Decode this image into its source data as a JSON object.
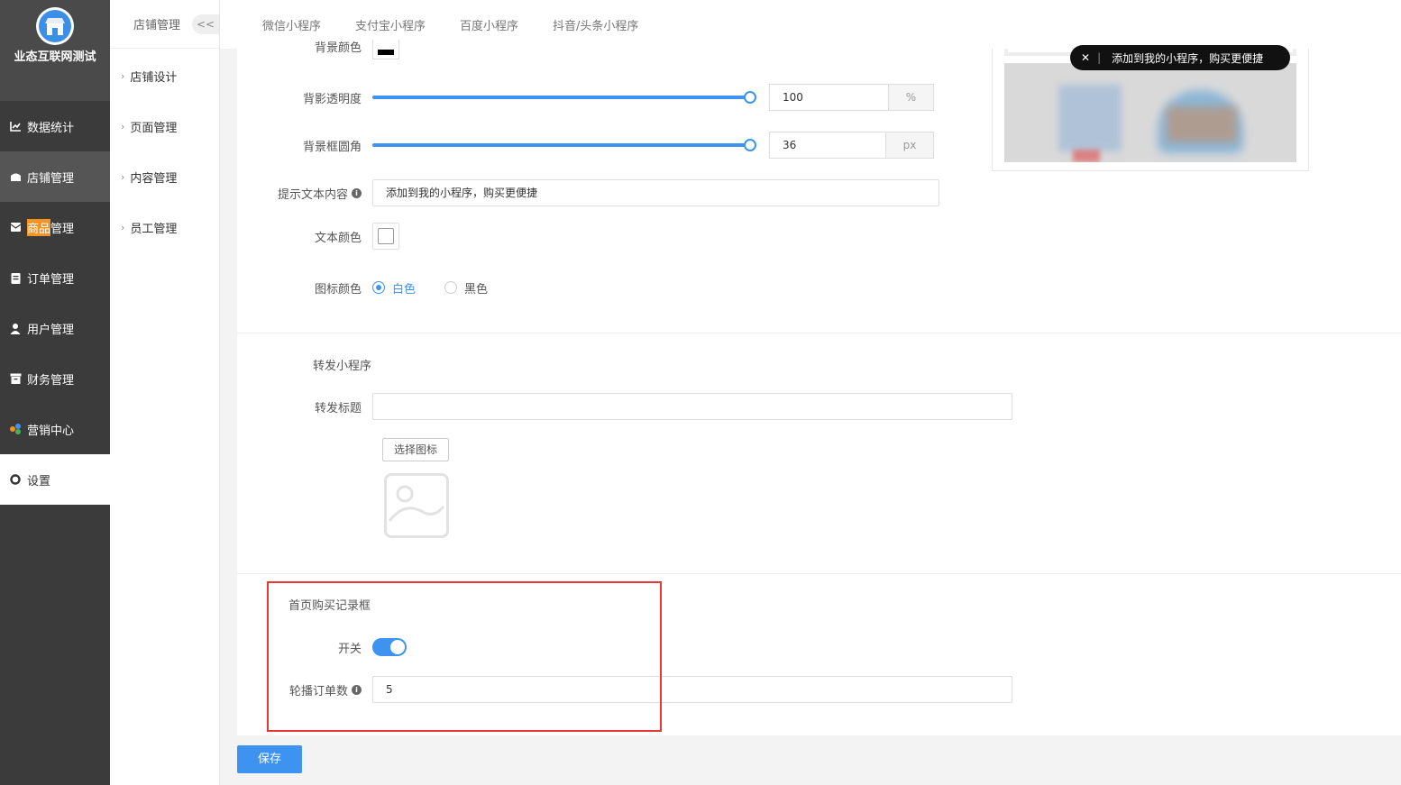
{
  "brand": {
    "name": "业态互联网测试"
  },
  "sidebar": {
    "items": [
      {
        "label": "数据统计",
        "icon": "chart-line-icon"
      },
      {
        "label": "店铺管理",
        "icon": "store-icon"
      },
      {
        "label_highlight": "商品",
        "label_rest": "管理",
        "icon": "mail-box-icon"
      },
      {
        "label": "订单管理",
        "icon": "clipboard-icon"
      },
      {
        "label": "用户管理",
        "icon": "user-icon"
      },
      {
        "label": "财务管理",
        "icon": "archive-icon"
      },
      {
        "label": "营销中心",
        "icon": "marketing-icon"
      },
      {
        "label": "设置",
        "icon": "gear-icon"
      }
    ]
  },
  "subnav": {
    "title": "店铺管理",
    "collapse": "<<",
    "items": [
      "店铺设计",
      "页面管理",
      "内容管理",
      "员工管理"
    ]
  },
  "tabs": [
    "微信小程序",
    "支付宝小程序",
    "百度小程序",
    "抖音/头条小程序"
  ],
  "form": {
    "partial_label": "背景颜色",
    "opacity": {
      "label": "背影透明度",
      "value": "100",
      "unit": "%",
      "level": 1.0
    },
    "radius": {
      "label": "背景框圆角",
      "value": "36",
      "unit": "px",
      "level": 1.0
    },
    "tip_text": {
      "label": "提示文本内容",
      "value": "添加到我的小程序，购买更便捷"
    },
    "text_color": {
      "label": "文本颜色",
      "color": "#ffffff"
    },
    "icon_color": {
      "label": "图标颜色",
      "options": [
        "白色",
        "黑色"
      ],
      "selected": "白色"
    }
  },
  "share": {
    "section_title": "转发小程序",
    "title_label": "转发标题",
    "title_value": "",
    "choose_icon": "选择图标"
  },
  "purchase": {
    "section_title": "首页购买记录框",
    "switch_label": "开关",
    "switch_on": true,
    "count_label": "轮播订单数",
    "count_value": "5"
  },
  "preview": {
    "pill_text": "添加到我的小程序，购买更便捷",
    "close": "✕",
    "sep": "|"
  },
  "save_label": "保存",
  "colors": {
    "accent": "#3f93f0",
    "sidebar": "#3b3b3b",
    "highlight": "#f7941d",
    "annotation": "#e53935"
  }
}
